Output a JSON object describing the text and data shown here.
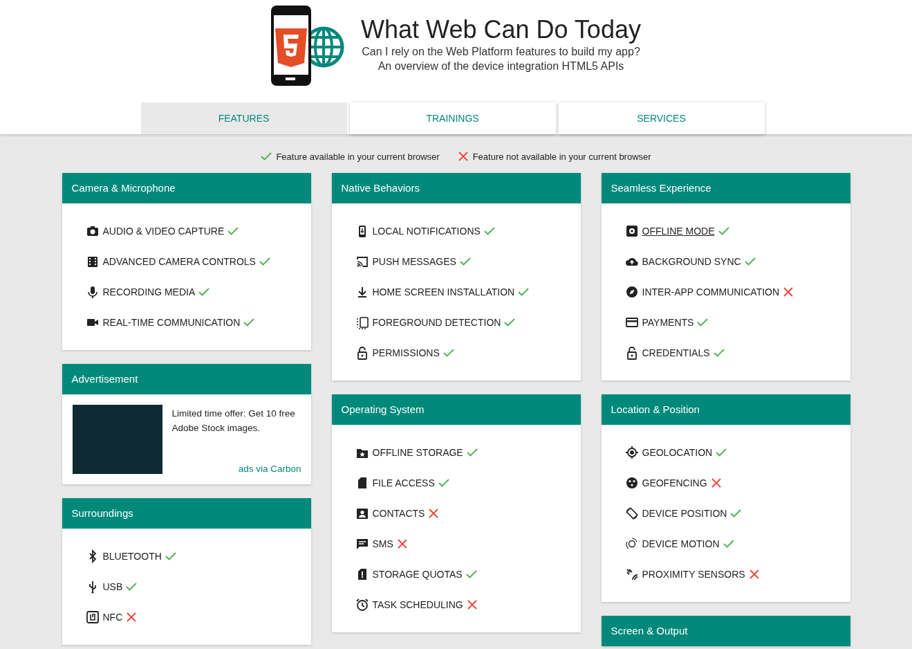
{
  "header": {
    "title": "What Web Can Do Today",
    "subtitle_lines": [
      "Can I rely on the Web Platform features to build my app?",
      "An overview of the device integration HTML5 APIs"
    ]
  },
  "tabs": [
    {
      "label": "FEATURES",
      "selected": true
    },
    {
      "label": "TRAININGS",
      "selected": false
    },
    {
      "label": "SERVICES",
      "selected": false
    }
  ],
  "legend": [
    {
      "available": true,
      "label": "Feature available in your current browser"
    },
    {
      "available": false,
      "label": "Feature not available in your current browser"
    }
  ],
  "columns": [
    {
      "cards": [
        {
          "kind": "features",
          "title": "Camera & Microphone",
          "items": [
            {
              "label": "AUDIO & VIDEO CAPTURE",
              "available": true,
              "underlined": false
            },
            {
              "label": "ADVANCED CAMERA CONTROLS",
              "available": true,
              "underlined": false
            },
            {
              "label": "RECORDING MEDIA",
              "available": true,
              "underlined": false
            },
            {
              "label": "REAL-TIME COMMUNICATION",
              "available": true,
              "underlined": false
            }
          ]
        },
        {
          "kind": "ad",
          "title": "Advertisement",
          "text": "Limited time offer: Get 10 free Adobe Stock images.",
          "link": "ads via Carbon"
        },
        {
          "kind": "features",
          "title": "Surroundings",
          "items": [
            {
              "label": "BLUETOOTH",
              "available": true,
              "underlined": false
            },
            {
              "label": "USB",
              "available": true,
              "underlined": false
            },
            {
              "label": "NFC",
              "available": false,
              "underlined": false
            }
          ]
        }
      ]
    },
    {
      "cards": [
        {
          "kind": "features",
          "title": "Native Behaviors",
          "items": [
            {
              "label": "LOCAL NOTIFICATIONS",
              "available": true,
              "underlined": false
            },
            {
              "label": "PUSH MESSAGES",
              "available": true,
              "underlined": false
            },
            {
              "label": "HOME SCREEN INSTALLATION",
              "available": true,
              "underlined": false
            },
            {
              "label": "FOREGROUND DETECTION",
              "available": true,
              "underlined": false
            },
            {
              "label": "PERMISSIONS",
              "available": true,
              "underlined": false
            }
          ]
        },
        {
          "kind": "features",
          "title": "Operating System",
          "items": [
            {
              "label": "OFFLINE STORAGE",
              "available": true,
              "underlined": false
            },
            {
              "label": "FILE ACCESS",
              "available": true,
              "underlined": false
            },
            {
              "label": "CONTACTS",
              "available": false,
              "underlined": false
            },
            {
              "label": "SMS",
              "available": false,
              "underlined": false
            },
            {
              "label": "STORAGE QUOTAS",
              "available": true,
              "underlined": false
            },
            {
              "label": "TASK SCHEDULING",
              "available": false,
              "underlined": false
            }
          ]
        }
      ]
    },
    {
      "cards": [
        {
          "kind": "features",
          "title": "Seamless Experience",
          "items": [
            {
              "label": "OFFLINE MODE",
              "available": true,
              "underlined": true
            },
            {
              "label": "BACKGROUND SYNC",
              "available": true,
              "underlined": false
            },
            {
              "label": "INTER-APP COMMUNICATION",
              "available": false,
              "underlined": false
            },
            {
              "label": "PAYMENTS",
              "available": true,
              "underlined": false
            },
            {
              "label": "CREDENTIALS",
              "available": true,
              "underlined": false
            }
          ]
        },
        {
          "kind": "features",
          "title": "Location & Position",
          "items": [
            {
              "label": "GEOLOCATION",
              "available": true,
              "underlined": false
            },
            {
              "label": "GEOFENCING",
              "available": false,
              "underlined": false
            },
            {
              "label": "DEVICE POSITION",
              "available": true,
              "underlined": false
            },
            {
              "label": "DEVICE MOTION",
              "available": true,
              "underlined": false
            },
            {
              "label": "PROXIMITY SENSORS",
              "available": false,
              "underlined": false
            }
          ]
        },
        {
          "kind": "features",
          "title": "Screen & Output"
        }
      ]
    }
  ]
}
